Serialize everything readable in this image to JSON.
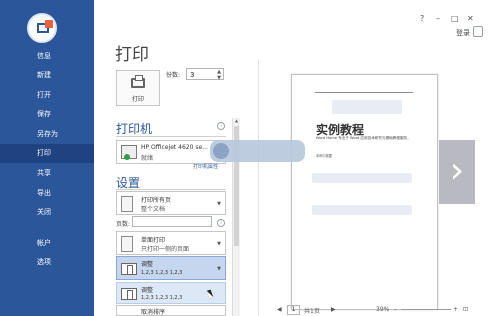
{
  "sidebar": {
    "items": [
      {
        "label": "信息",
        "active": false
      },
      {
        "label": "新建",
        "active": false
      },
      {
        "label": "打开",
        "active": false
      },
      {
        "label": "保存",
        "active": false
      },
      {
        "label": "另存为",
        "active": false
      },
      {
        "label": "打印",
        "active": true
      },
      {
        "label": "共享",
        "active": false
      },
      {
        "label": "导出",
        "active": false
      },
      {
        "label": "关闭",
        "active": false
      },
      {
        "label": "帐户",
        "active": false
      },
      {
        "label": "选项",
        "active": false
      }
    ]
  },
  "window": {
    "help": "?",
    "minimize": "–",
    "restore": "□",
    "close": "✕",
    "login": "登录"
  },
  "page": {
    "title": "打印",
    "print_button_label": "打印",
    "copies_label": "份数:",
    "copies_value": "3"
  },
  "printer": {
    "heading": "打印机",
    "name": "HP Officejet 4620 se...",
    "status": "就绪",
    "properties_link": "打印机属性"
  },
  "settings": {
    "heading": "设置",
    "range": {
      "title": "打印所有页",
      "subtitle": "整个文档"
    },
    "pages_label": "页数:",
    "sides": {
      "title": "单面打印",
      "subtitle": "只打印一侧的页面"
    },
    "collate_selected": {
      "title": "调整",
      "sequence": "1,2,3   1,2,3   1,2,3"
    },
    "collate_option1": {
      "title": "调整",
      "sequence": "1,2,3   1,2,3   1,2,3"
    },
    "collate_option2": {
      "title": "取消排序"
    }
  },
  "preview": {
    "heading": "实例教程",
    "body": "Word Home 专业于 Word 应用技术研究与基础教程服务。",
    "small": "本例中需要"
  },
  "bottom": {
    "page_current": "1",
    "page_total": "共1页",
    "zoom": "39%"
  },
  "colors": {
    "sidebar": "#2b579a",
    "sidebar_active": "#1e4380",
    "accent": "#2b579a"
  }
}
